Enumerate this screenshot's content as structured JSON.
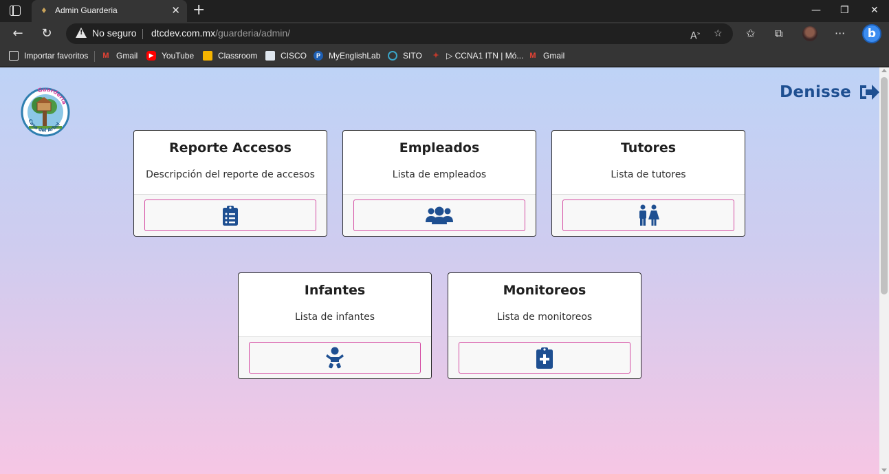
{
  "browser": {
    "tab_title": "Admin Guarderia",
    "security_label": "No seguro",
    "url_host": "dtcdev.com.mx",
    "url_path": "/guarderia/admin/",
    "bookmarks": [
      {
        "label": "Importar favoritos",
        "icon": "import-icon"
      },
      {
        "label": "Gmail",
        "icon": "gmail-icon"
      },
      {
        "label": "YouTube",
        "icon": "youtube-icon"
      },
      {
        "label": "Classroom",
        "icon": "classroom-icon"
      },
      {
        "label": "CISCO",
        "icon": "cisco-icon"
      },
      {
        "label": "MyEnglishLab",
        "icon": "myenglishlab-icon"
      },
      {
        "label": "SITO",
        "icon": "sito-icon"
      },
      {
        "label": "▷ CCNA1 ITN | Mó...",
        "icon": "ccna-icon"
      },
      {
        "label": "Gmail",
        "icon": "gmail-icon"
      }
    ]
  },
  "header": {
    "logo_text_top": "Guarderia",
    "logo_text_bottom": "Casa del Arbol",
    "user_name": "Denisse",
    "logout_icon": "logout-icon"
  },
  "colors": {
    "accent": "#1e4f91",
    "button_border": "#d44aa2",
    "bg_top": "#bed3f6",
    "bg_bottom": "#f6c6e4"
  },
  "cards": [
    {
      "title": "Reporte Accesos",
      "description": "Descripción del reporte de accesos",
      "icon": "clipboard-list-icon"
    },
    {
      "title": "Empleados",
      "description": "Lista de empleados",
      "icon": "users-icon"
    },
    {
      "title": "Tutores",
      "description": "Lista de tutores",
      "icon": "restroom-icon"
    },
    {
      "title": "Infantes",
      "description": "Lista de infantes",
      "icon": "baby-icon"
    },
    {
      "title": "Monitoreos",
      "description": "Lista de monitoreos",
      "icon": "file-medical-icon"
    }
  ]
}
